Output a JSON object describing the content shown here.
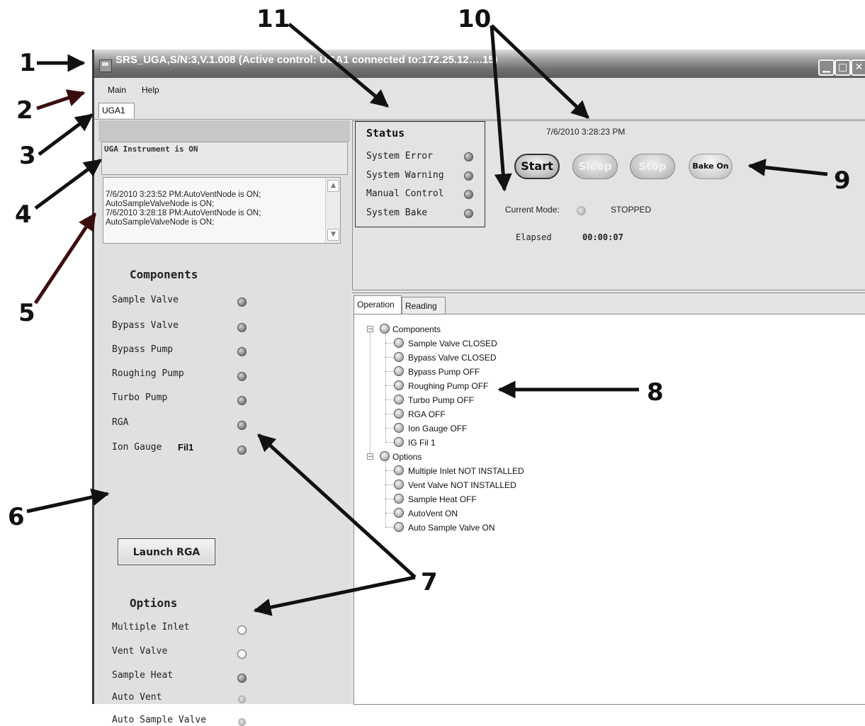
{
  "window": {
    "title": "SRS_UGA,S/N:3,V.1.008  (Active control: UGA1 connected to:172.25.12….15)",
    "controls": [
      "minimize-icon",
      "maximize-icon",
      "close-icon"
    ]
  },
  "menu": {
    "items": [
      {
        "label": "Main"
      },
      {
        "label": "Help"
      }
    ]
  },
  "instrument_tab": {
    "label": "UGA1"
  },
  "instrument_status": "UGA Instrument is ON",
  "log": {
    "lines": [
      "7/6/2010 3:23:52 PM:AutoVentNode is ON;",
      "AutoSampleValveNode is ON;",
      "7/6/2010 3:28:18 PM:AutoVentNode is ON;",
      "AutoSampleValveNode is ON;"
    ]
  },
  "components": {
    "title": "Components",
    "items": [
      {
        "label": "Sample Valve"
      },
      {
        "label": "Bypass Valve"
      },
      {
        "label": "Bypass Pump"
      },
      {
        "label": "Roughing Pump"
      },
      {
        "label": "Turbo Pump"
      },
      {
        "label": "RGA"
      },
      {
        "label": "Ion Gauge",
        "extra": "Fil1"
      }
    ]
  },
  "launch_button": {
    "label": "Launch RGA"
  },
  "options": {
    "title": "Options",
    "items": [
      {
        "label": "Multiple Inlet",
        "led": "empty"
      },
      {
        "label": "Vent Valve",
        "led": "empty"
      },
      {
        "label": "Sample Heat",
        "led": "dark"
      },
      {
        "label": "Auto Vent",
        "led": "light"
      },
      {
        "label": "Auto Sample Valve",
        "led": "light"
      }
    ]
  },
  "status": {
    "title": "Status",
    "items": [
      {
        "label": "System Error"
      },
      {
        "label": "System Warning"
      },
      {
        "label": "Manual Control"
      },
      {
        "label": "System Bake"
      }
    ]
  },
  "datetime": "7/6/2010 3:28:23 PM",
  "mode_buttons": {
    "start": "Start",
    "sleep": "Sleep",
    "stop": "Stop",
    "bake": "Bake On"
  },
  "current_mode": {
    "label": "Current Mode:",
    "value": "STOPPED"
  },
  "elapsed": {
    "label": "Elapsed",
    "value": "00:00:07"
  },
  "bottom_tabs": [
    {
      "label": "Operation"
    },
    {
      "label": "Reading"
    }
  ],
  "tree": {
    "groups": [
      {
        "label": "Components",
        "children": [
          "Sample Valve  CLOSED",
          "Bypass Valve  CLOSED",
          "Bypass Pump  OFF",
          "Roughing Pump  OFF",
          "Turbo Pump  OFF",
          "RGA  OFF",
          "Ion Gauge  OFF",
          "IG  Fil 1"
        ]
      },
      {
        "label": "Options",
        "children": [
          "Multiple Inlet  NOT INSTALLED",
          "Vent Valve  NOT INSTALLED",
          "Sample Heat  OFF",
          "AutoVent  ON",
          "Auto Sample Valve  ON"
        ]
      }
    ]
  },
  "callouts": [
    "1",
    "2",
    "3",
    "4",
    "5",
    "6",
    "7",
    "8",
    "9",
    "10",
    "11"
  ]
}
